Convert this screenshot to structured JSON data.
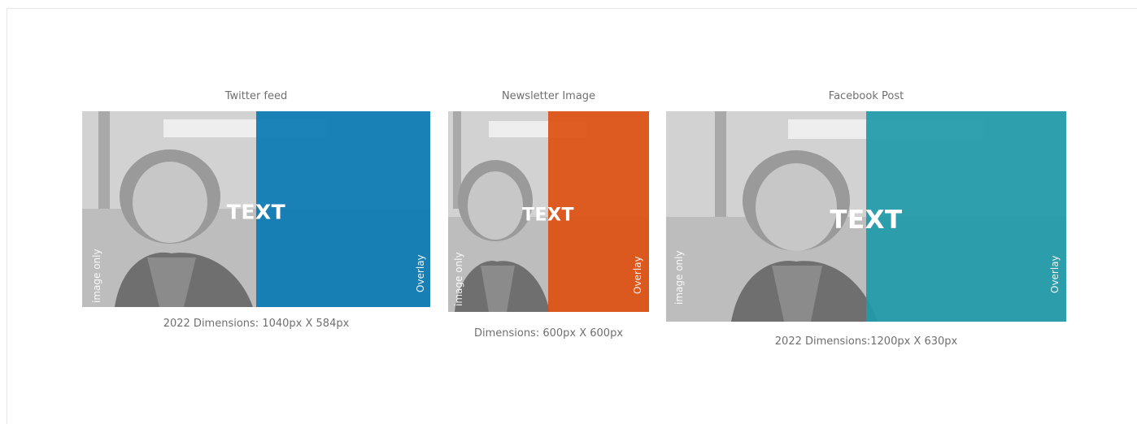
{
  "panels": [
    {
      "title": "Twitter feed",
      "caption": "2022 Dimensions: 1040px X 584px",
      "headline": "TEXT",
      "left_label": "image only",
      "right_label": "Overlay",
      "overlay_color": "#0a7ab4"
    },
    {
      "title": "Newsletter Image",
      "caption": "Dimensions: 600px X 600px",
      "headline": "TEXT",
      "left_label": "image only",
      "right_label": "Overlay",
      "overlay_color": "#dd4f10"
    },
    {
      "title": "Facebook Post",
      "caption": "2022 Dimensions:1200px X 630px",
      "headline": "TEXT",
      "left_label": "image only",
      "right_label": "Overlay",
      "overlay_color": "#1f9aa8"
    }
  ]
}
